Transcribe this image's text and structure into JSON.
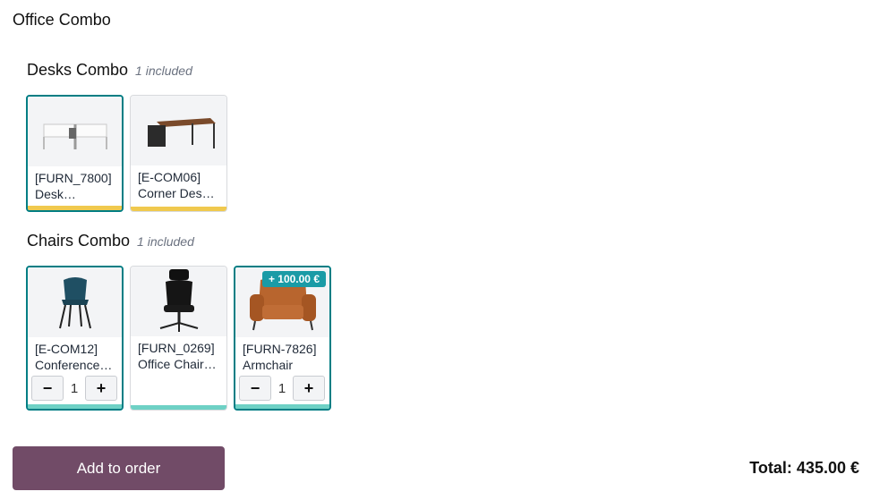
{
  "title": "Office Combo",
  "sections": [
    {
      "name": "Desks Combo",
      "subtitle": "1 included",
      "items": [
        {
          "code": "[FURN_7800]",
          "name": "Desk…"
        },
        {
          "code": "[E-COM06]",
          "name": "Corner Desk…"
        }
      ]
    },
    {
      "name": "Chairs Combo",
      "subtitle": "1 included",
      "items": [
        {
          "code": "[E-COM12]",
          "name": "Conference…",
          "qty": "1"
        },
        {
          "code": "[FURN_0269]",
          "name": "Office Chair…"
        },
        {
          "code": "[FURN-7826]",
          "name": "Armchair",
          "qty": "1",
          "extra_price": "+ 100.00 €"
        }
      ]
    }
  ],
  "footer": {
    "add_button": "Add to order",
    "total": "Total: 435.00 €"
  },
  "colors": {
    "selected_border": "#017e84",
    "desk_bar": "#f0c94e",
    "chair_bar": "#6ed1c5",
    "primary_button": "#714b67",
    "price_badge": "#1a9ba6"
  },
  "icons": [
    "desk-image-icon",
    "corner-desk-image-icon",
    "chair-image-icon",
    "office-chair-image-icon",
    "armchair-image-icon",
    "minus-icon",
    "plus-icon"
  ]
}
